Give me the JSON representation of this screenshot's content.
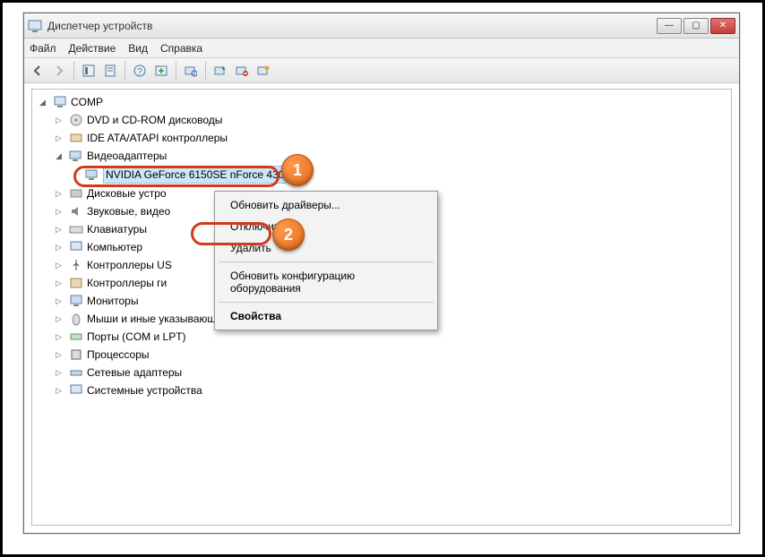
{
  "window": {
    "title": "Диспетчер устройств"
  },
  "menu": {
    "file": "Файл",
    "action": "Действие",
    "view": "Вид",
    "help": "Справка"
  },
  "tree": {
    "root": "COMP",
    "items": [
      "DVD и CD-ROM дисководы",
      "IDE ATA/ATAPI контроллеры",
      "Видеоадаптеры",
      "Дисковые устро",
      "Звуковые, видео",
      "Клавиатуры",
      "Компьютер",
      "Контроллеры US",
      "Контроллеры ги",
      "Мониторы",
      "Мыши и иные указывающие устройства",
      "Порты (COM и LPT)",
      "Процессоры",
      "Сетевые адаптеры",
      "Системные устройства"
    ],
    "video_device": "NVIDIA GeForce 6150SE nForce 430"
  },
  "context_menu": {
    "update": "Обновить драйверы...",
    "disable": "Отключить",
    "delete": "Удалить",
    "scan": "Обновить конфигурацию оборудования",
    "properties": "Свойства"
  },
  "markers": {
    "one": "1",
    "two": "2"
  }
}
